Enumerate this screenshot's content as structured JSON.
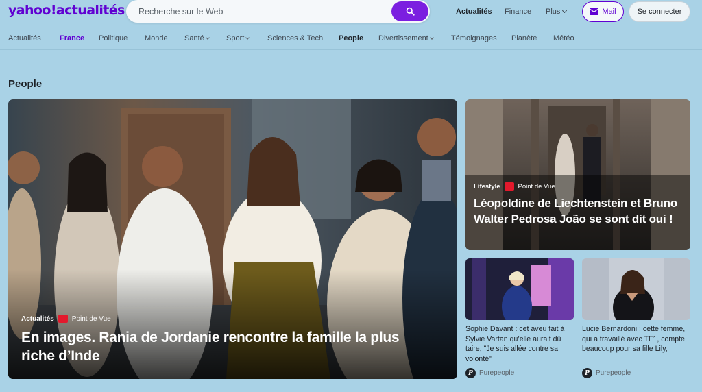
{
  "brand": {
    "logo_text": "yahoo!actualités",
    "accent_color": "#6001d2"
  },
  "search": {
    "placeholder": "Recherche sur le Web",
    "button_icon": "search-icon"
  },
  "top_nav": {
    "actualites": "Actualités",
    "finance": "Finance",
    "plus": "Plus",
    "mail": "Mail",
    "login": "Se connecter"
  },
  "nav": {
    "items": [
      {
        "label": "Actualités",
        "state": "normal"
      },
      {
        "label": "France",
        "state": "active"
      },
      {
        "label": "Politique",
        "state": "normal"
      },
      {
        "label": "Monde",
        "state": "normal"
      },
      {
        "label": "Santé",
        "state": "normal",
        "dropdown": true
      },
      {
        "label": "Sport",
        "state": "normal",
        "dropdown": true
      },
      {
        "label": "Sciences & Tech",
        "state": "normal"
      },
      {
        "label": "People",
        "state": "current"
      },
      {
        "label": "Divertissement",
        "state": "normal",
        "dropdown": true
      },
      {
        "label": "Témoignages",
        "state": "normal"
      },
      {
        "label": "Planète",
        "state": "normal"
      },
      {
        "label": "Météo",
        "state": "normal"
      }
    ]
  },
  "section": {
    "title": "People"
  },
  "hero": {
    "category": "Actualités",
    "source": "Point de Vue",
    "title": "En images. Rania de Jordanie rencontre la famille la plus riche d’Inde"
  },
  "card2": {
    "category": "Lifestyle",
    "source": "Point de Vue",
    "title": "Léopoldine de Liechtenstein et Bruno Walter Pedrosa João se sont dit oui !"
  },
  "small_cards": [
    {
      "title": "Sophie Davant : cet aveu fait à Sylvie Vartan qu’elle aurait dû taire, \"Je suis allée contre sa volonté\"",
      "source": "Purepeople"
    },
    {
      "title": "Lucie Bernardoni : cette femme, qui a travaillé avec TF1, compte beaucoup pour sa fille Lily,",
      "source": "Purepeople"
    }
  ]
}
